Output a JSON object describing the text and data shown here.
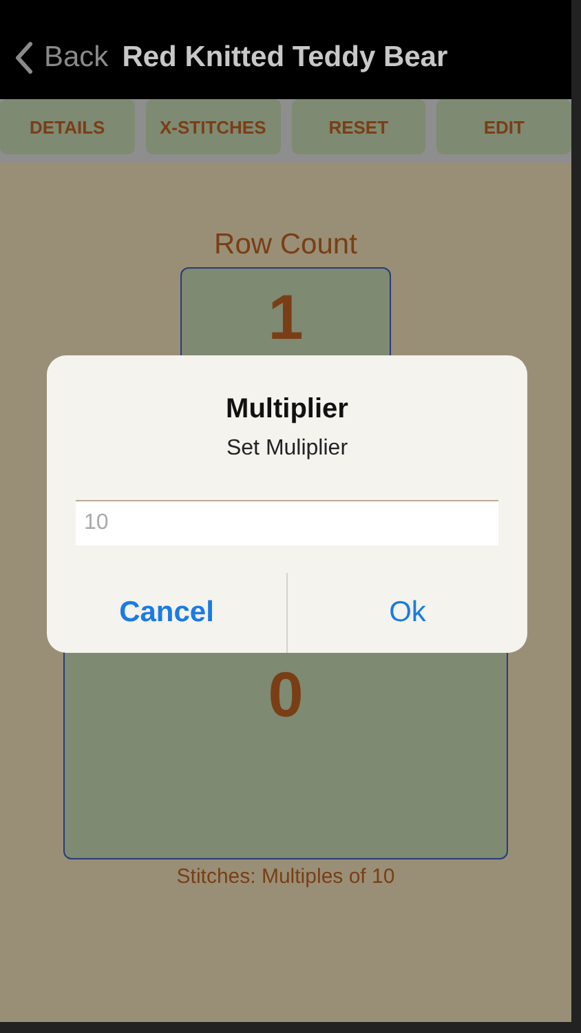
{
  "nav": {
    "back": "Back",
    "title": "Red Knitted Teddy Bear"
  },
  "toolbar": [
    "DETAILS",
    "X-STITCHES",
    "RESET",
    "EDIT"
  ],
  "row_counter": {
    "label": "Row Count",
    "value": "1"
  },
  "stitch_counter": {
    "value": "0",
    "caption": "Stitches: Multiples of 10"
  },
  "dialog": {
    "title": "Multiplier",
    "message": "Set Muliplier",
    "input": {
      "placeholder": "10"
    },
    "buttons": [
      {
        "label": "Cancel",
        "kind": "cancel"
      },
      {
        "label": "Ok",
        "kind": "default"
      }
    ]
  }
}
